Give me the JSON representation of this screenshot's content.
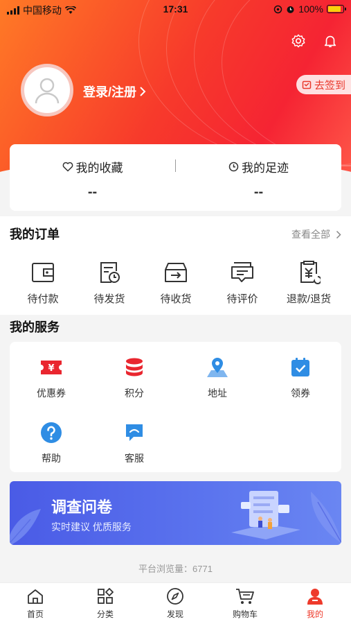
{
  "status_bar": {
    "carrier": "中国移动",
    "time": "17:31",
    "battery": "100%"
  },
  "header": {
    "login_label": "登录/注册",
    "signin_label": "去签到"
  },
  "favorites": {
    "items": [
      {
        "label": "我的收藏",
        "value": "--"
      },
      {
        "label": "我的足迹",
        "value": "--"
      }
    ]
  },
  "orders": {
    "title": "我的订单",
    "see_all": "查看全部",
    "items": [
      {
        "label": "待付款",
        "icon": "wallet-icon"
      },
      {
        "label": "待发货",
        "icon": "doc-clock-icon"
      },
      {
        "label": "待收货",
        "icon": "box-icon"
      },
      {
        "label": "待评价",
        "icon": "comment-icon"
      },
      {
        "label": "退款/退货",
        "icon": "refund-icon"
      }
    ]
  },
  "services": {
    "title": "我的服务",
    "items": [
      {
        "label": "优惠券",
        "icon": "coupon-icon",
        "color": "#e9262f"
      },
      {
        "label": "积分",
        "icon": "points-icon",
        "color": "#e9262f"
      },
      {
        "label": "地址",
        "icon": "location-icon",
        "color": "#2f8de4"
      },
      {
        "label": "领券",
        "icon": "calendar-check-icon",
        "color": "#2f8de4"
      },
      {
        "label": "帮助",
        "icon": "help-icon",
        "color": "#2f8de4"
      },
      {
        "label": "客服",
        "icon": "chat-icon",
        "color": "#2f8de4"
      }
    ]
  },
  "banner": {
    "title": "调查问卷",
    "subtitle": "实时建议  优质服务"
  },
  "footer": {
    "views_label": "平台浏览量：6771"
  },
  "tabbar": {
    "items": [
      {
        "label": "首页",
        "icon": "home-icon"
      },
      {
        "label": "分类",
        "icon": "category-icon"
      },
      {
        "label": "发现",
        "icon": "compass-icon"
      },
      {
        "label": "购物车",
        "icon": "cart-icon"
      },
      {
        "label": "我的",
        "icon": "profile-icon",
        "active": true
      }
    ]
  },
  "colors": {
    "accent": "#ee3a2b",
    "service_red": "#e9262f",
    "service_blue": "#2f8de4",
    "banner_blue": "#4a5be6"
  }
}
